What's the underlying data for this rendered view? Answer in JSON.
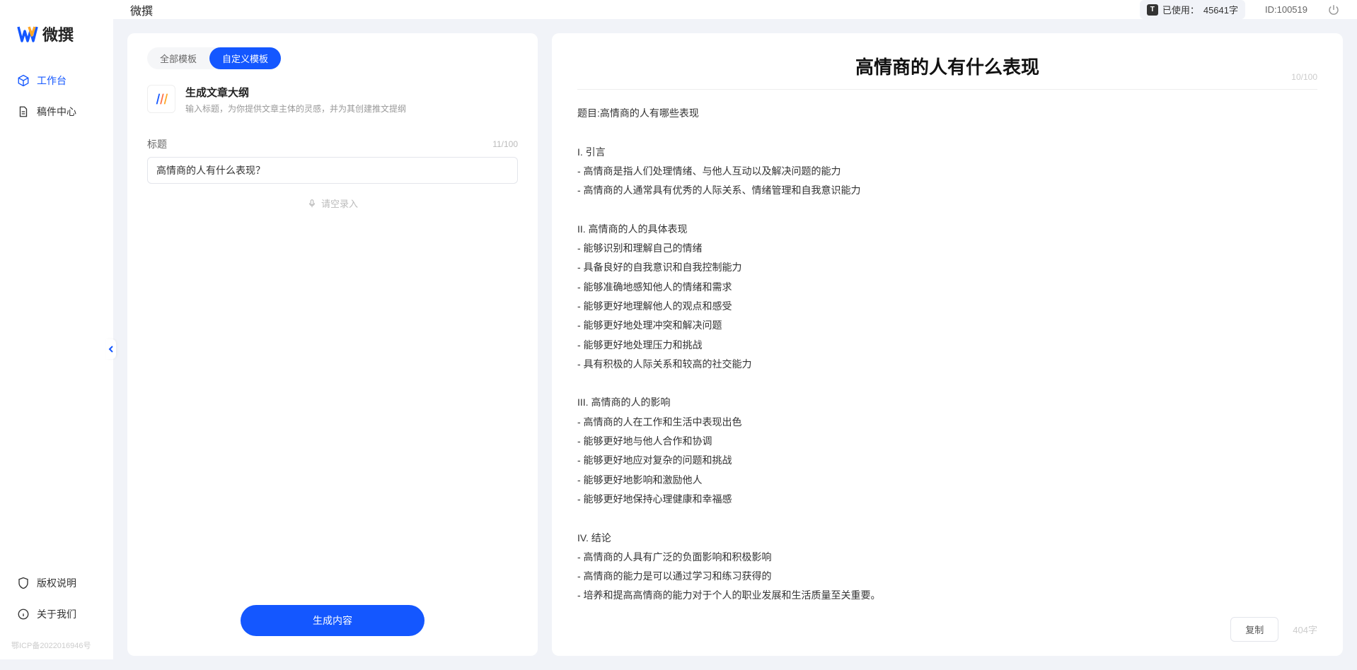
{
  "app": {
    "name": "微撰",
    "logo_text": "微撰"
  },
  "topbar": {
    "usage_label": "已使用：",
    "usage_value": "45641字",
    "user_id": "ID:100519"
  },
  "sidebar": {
    "nav": [
      {
        "label": "工作台",
        "active": true
      },
      {
        "label": "稿件中心",
        "active": false
      }
    ],
    "footer": [
      {
        "label": "版权说明"
      },
      {
        "label": "关于我们"
      }
    ],
    "icp": "鄂ICP备2022016946号"
  },
  "left": {
    "tabs": [
      {
        "label": "全部模板",
        "active": false
      },
      {
        "label": "自定义模板",
        "active": true
      }
    ],
    "template": {
      "title": "生成文章大纲",
      "desc": "输入标题，为你提供文章主体的灵感，并为其创建推文提纲"
    },
    "field": {
      "label": "标题",
      "count": "11/100",
      "value": "高情商的人有什么表现？"
    },
    "voice_label": "请空录入",
    "generate_btn": "生成内容"
  },
  "right": {
    "title": "高情商的人有什么表现",
    "title_count": "10/100",
    "body": "题目:高情商的人有哪些表现\n\nI. 引言\n- 高情商是指人们处理情绪、与他人互动以及解决问题的能力\n- 高情商的人通常具有优秀的人际关系、情绪管理和自我意识能力\n\nII. 高情商的人的具体表现\n- 能够识别和理解自己的情绪\n- 具备良好的自我意识和自我控制能力\n- 能够准确地感知他人的情绪和需求\n- 能够更好地理解他人的观点和感受\n- 能够更好地处理冲突和解决问题\n- 能够更好地处理压力和挑战\n- 具有积极的人际关系和较高的社交能力\n\nIII. 高情商的人的影响\n- 高情商的人在工作和生活中表现出色\n- 能够更好地与他人合作和协调\n- 能够更好地应对复杂的问题和挑战\n- 能够更好地影响和激励他人\n- 能够更好地保持心理健康和幸福感\n\nIV. 结论\n- 高情商的人具有广泛的负面影响和积极影响\n- 高情商的能力是可以通过学习和练习获得的\n- 培养和提高高情商的能力对于个人的职业发展和生活质量至关重要。",
    "copy_btn": "复制",
    "word_count": "404字"
  }
}
